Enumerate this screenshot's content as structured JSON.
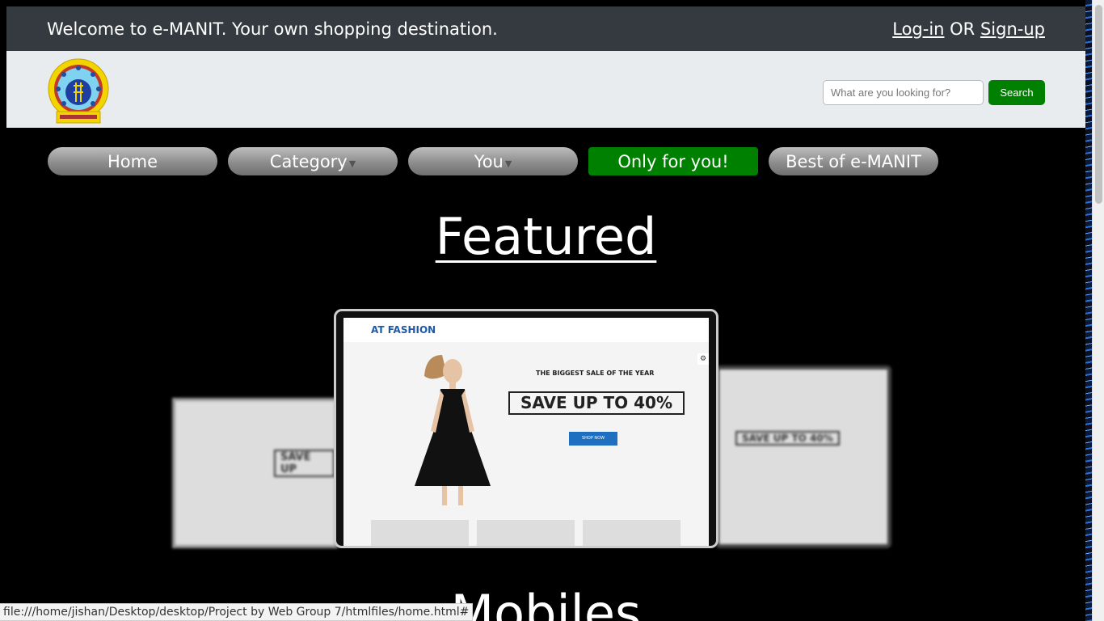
{
  "topbar": {
    "welcome": "Welcome to e-MANIT. Your own shopping destination.",
    "login": "Log-in",
    "or": "OR",
    "signup": "Sign-up",
    "bg_color": "#343a40"
  },
  "header": {
    "logo_icon": "manit-logo",
    "search_placeholder": "What are you looking for?",
    "search_value": "",
    "search_button": "Search",
    "bg_color": "#e9ecef",
    "search_color": "#008000"
  },
  "nav": {
    "items": [
      {
        "label": "Home",
        "dropdown": false
      },
      {
        "label": "Category",
        "dropdown": true
      },
      {
        "label": "You",
        "dropdown": true
      },
      {
        "label": "Only for you!",
        "dropdown": false,
        "active": true
      },
      {
        "label": "Best of e-MANIT",
        "dropdown": false
      }
    ],
    "active_color": "#008000"
  },
  "featured": {
    "title": "Featured",
    "hero": {
      "brand": "AT FASHION",
      "sale_subtitle": "THE BIGGEST SALE OF THE YEAR",
      "sale_headline": "SAVE UP TO 40%",
      "cta": "SHOP NOW"
    }
  },
  "mobiles": {
    "title": "Mobiles"
  },
  "status_bar": {
    "url": "file:///home/jishan/Desktop/desktop/Project by Web Group 7/htmlfiles/home.html#"
  }
}
